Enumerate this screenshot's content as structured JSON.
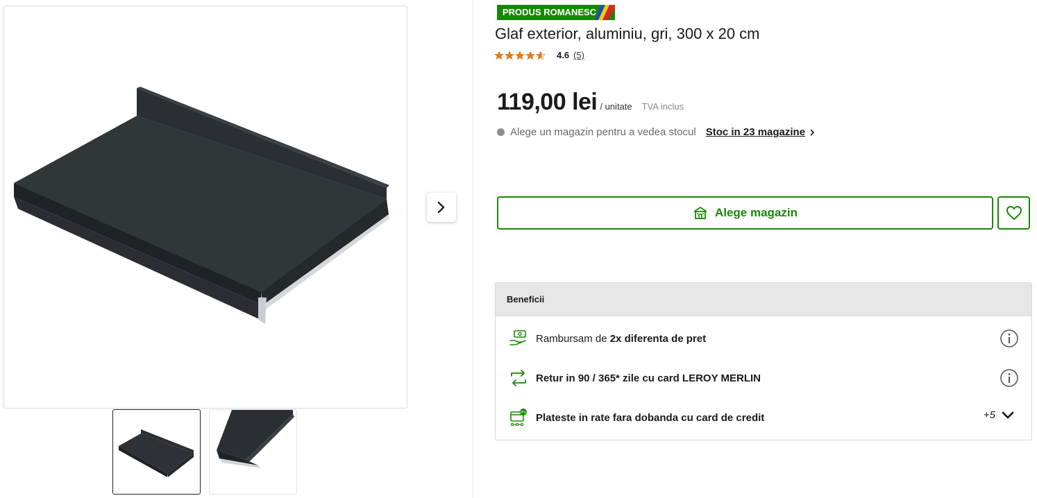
{
  "gallery": {
    "main_image_alt": "Glaf exterior aluminiu gri",
    "next_icon": "chevron-right-icon",
    "thumbnails": [
      "thumbnail-1",
      "thumbnail-2"
    ]
  },
  "product": {
    "badge": "PRODUS ROMANESC",
    "title": "Glaf exterior, aluminiu, gri, 300 x 20 cm",
    "rating": {
      "stars": 4.6,
      "value": "4.6",
      "count": "(5)"
    },
    "price": "119,00 lei",
    "unit": "/ unitate",
    "tva": "TVA inclus",
    "stock_message": "Alege un magazin pentru a vedea stocul",
    "stock_link": "Stoc in 23 magazine"
  },
  "actions": {
    "choose_store": "Alege magazin",
    "favorite_icon": "heart-icon",
    "accent_color": "#188803"
  },
  "benefits": {
    "header": "Beneficii",
    "items": [
      {
        "prefix": "Rambursam de ",
        "bold": "2x diferenta de pret",
        "icon": "money-hand-icon"
      },
      {
        "prefix": "",
        "bold": "Retur in 90 / 365* zile cu card LEROY MERLIN",
        "icon": "return-arrows-icon"
      },
      {
        "prefix": "",
        "bold": "Plateste in rate fara dobanda cu card de credit",
        "icon": "credit-card-percent-icon"
      }
    ],
    "more": "+5"
  }
}
